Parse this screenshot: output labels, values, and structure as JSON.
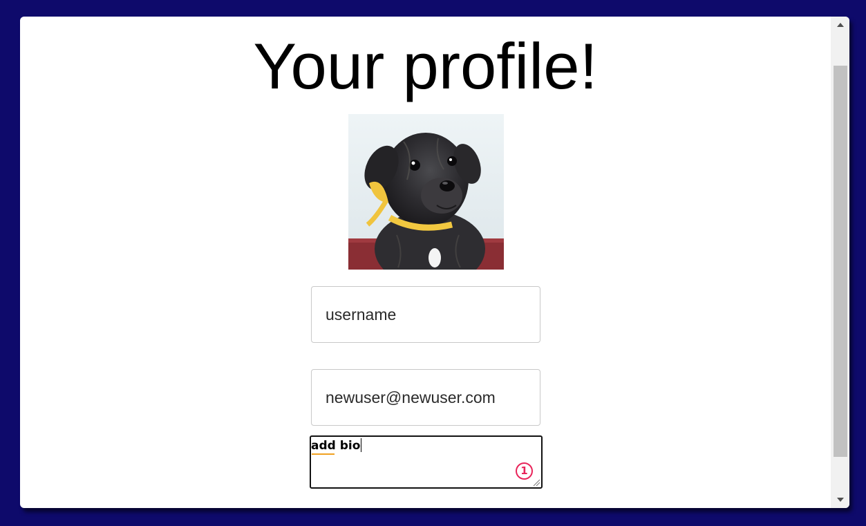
{
  "page": {
    "title": "Your profile!"
  },
  "avatar": {
    "alt": "puppy profile photo"
  },
  "form": {
    "username_value": "username",
    "email_value": "newuser@newuser.com",
    "bio_value": "add bio",
    "bio_badge": "1"
  },
  "icons": {
    "scroll_up": "scroll-up-arrow-icon",
    "scroll_down": "scroll-down-arrow-icon",
    "resize": "resize-grip-icon"
  },
  "colors": {
    "background": "#0e0a6b",
    "card": "#ffffff",
    "badge": "#e8245a",
    "spell_underline": "#f0a020"
  }
}
